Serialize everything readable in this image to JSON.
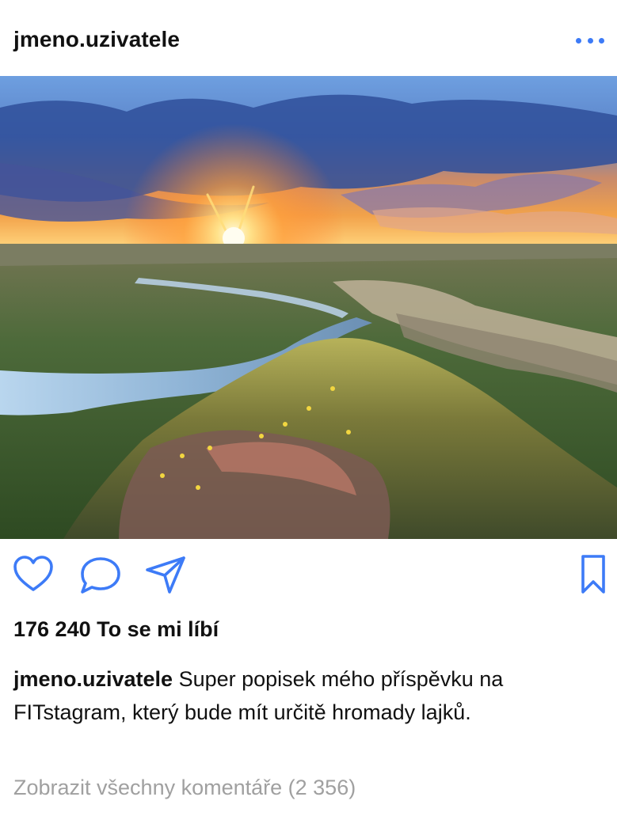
{
  "post": {
    "username": "jmeno.uzivatele",
    "more_icon": "more-horizontal-icon",
    "image": {
      "subject": "sunset over river valley"
    },
    "actions": {
      "like_icon": "heart-icon",
      "comment_icon": "comment-bubble-icon",
      "share_icon": "paper-plane-icon",
      "save_icon": "bookmark-icon"
    },
    "likes_text": "176 240 To se mi líbí",
    "caption": {
      "username": "jmeno.uzivatele",
      "text": " Super popisek mého příspěvku na FITstagram, který bude mít určitě hromady lajků."
    },
    "comments_link": "Zobrazit všechny komentáře (2 356)"
  },
  "colors": {
    "accent": "#3d7bf7",
    "text": "#111111",
    "muted": "#a0a0a0"
  }
}
